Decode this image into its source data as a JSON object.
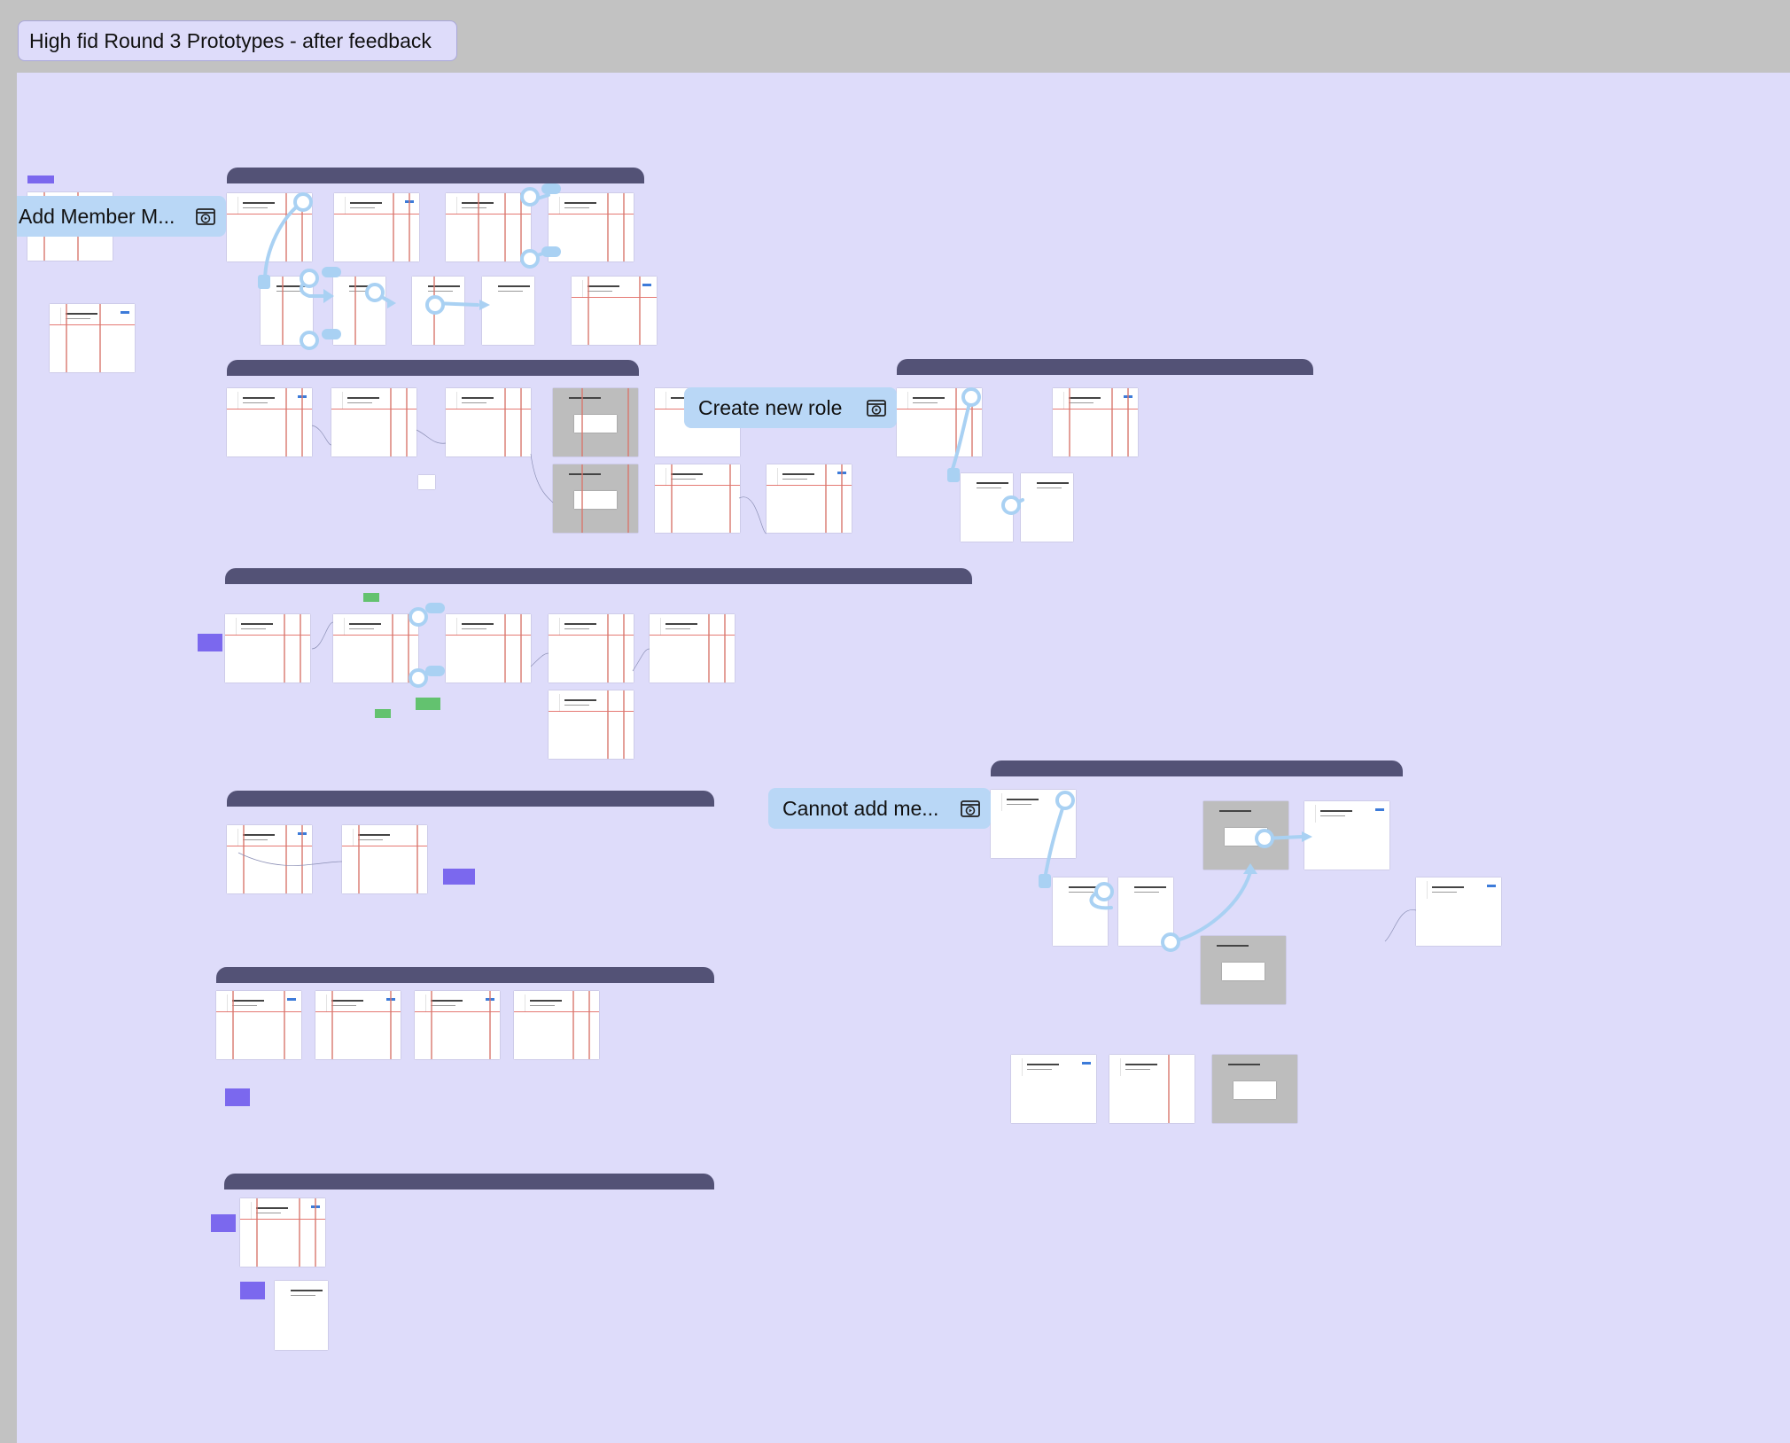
{
  "page": {
    "title": "High fid Round 3 Prototypes - after feedback"
  },
  "flows": [
    {
      "label": "Add Member M..."
    },
    {
      "label": "Create new role"
    },
    {
      "label": "Cannot add me..."
    }
  ],
  "icons": {
    "flow_start": "play-prototype-icon",
    "hotspot": "connection-node-icon"
  },
  "colors": {
    "canvas": "#dedcfa",
    "chrome": "#c2c2c2",
    "section_header": "#535276",
    "flow_pill": "#b9d7f6",
    "connector": "#a9d1f3",
    "sticky_note": "#7b68ee",
    "sticky_note_green": "#63c26f",
    "layout_guide": "#e0625a"
  }
}
